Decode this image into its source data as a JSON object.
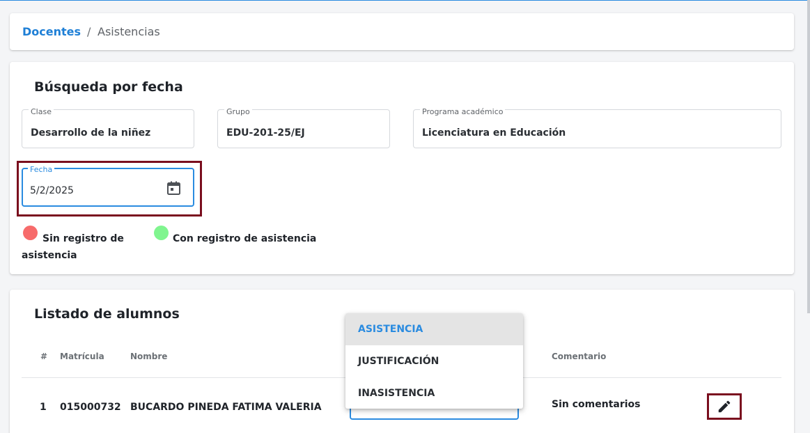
{
  "breadcrumb": {
    "parent": "Docentes",
    "separator": "/",
    "current": "Asistencias"
  },
  "search": {
    "title": "Búsqueda por fecha",
    "fields": {
      "clase": {
        "label": "Clase",
        "value": "Desarrollo de la niñez"
      },
      "grupo": {
        "label": "Grupo",
        "value": "EDU-201-25/EJ"
      },
      "programa": {
        "label": "Programa académico",
        "value": "Licenciatura en Educación"
      },
      "fecha": {
        "label": "Fecha",
        "value": "5/2/2025",
        "icon": "calendar-icon"
      }
    },
    "legend": {
      "no_record": {
        "line1": "Sin registro de",
        "line2": "asistencia",
        "color": "#f76b6b"
      },
      "with_record": {
        "text": "Con registro de asistencia",
        "color": "#80f58f"
      }
    }
  },
  "list": {
    "title": "Listado de alumnos",
    "columns": {
      "num": "#",
      "matricula": "Matrícula",
      "nombre": "Nombre",
      "comentario": "Comentario"
    },
    "rows": [
      {
        "num": "1",
        "matricula": "015000732",
        "nombre": "BUCARDO PINEDA FATIMA VALERIA",
        "comentario": "Sin comentarios",
        "action_icon": "pencil-icon"
      }
    ]
  },
  "status_menu": {
    "options": [
      "ASISTENCIA",
      "JUSTIFICACIÓN",
      "INASISTENCIA"
    ],
    "selected": "ASISTENCIA"
  },
  "colors": {
    "accent": "#2a8be0",
    "highlight": "#7a0e1e"
  }
}
